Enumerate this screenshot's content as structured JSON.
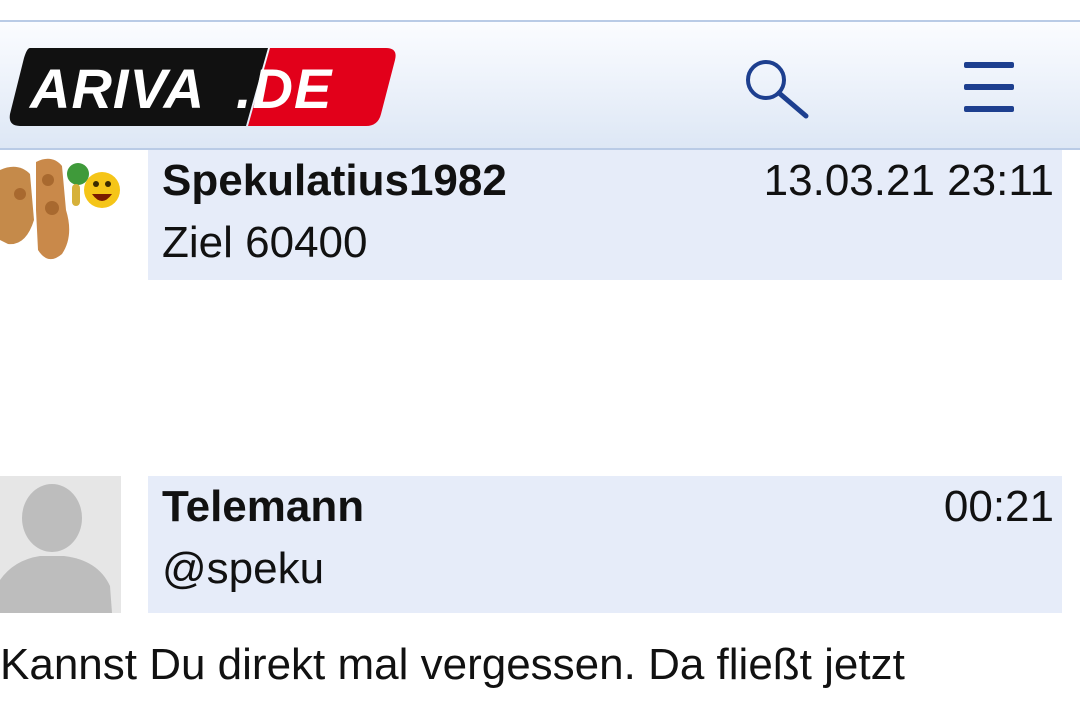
{
  "header": {
    "logo_text_left": "ARIVA",
    "logo_text_right": ".DE",
    "search_icon": "search-icon",
    "menu_icon": "hamburger-menu-icon"
  },
  "posts": [
    {
      "author": "Spekulatius1982",
      "time": "13.03.21 23:11",
      "excerpt": "Ziel 60400",
      "avatar": "speculoos-cookie-avatar"
    },
    {
      "author": "Telemann",
      "time": "00:21",
      "excerpt": "@speku",
      "avatar": "default-user-avatar"
    }
  ],
  "body_text": "Kannst Du direkt mal vergessen. Da fließt jetzt",
  "colors": {
    "card_bg": "#e6ecf9",
    "header_border": "#b9cbe6",
    "logo_red": "#e2001a",
    "logo_black": "#111111",
    "icon_blue": "#1d3f8f"
  }
}
